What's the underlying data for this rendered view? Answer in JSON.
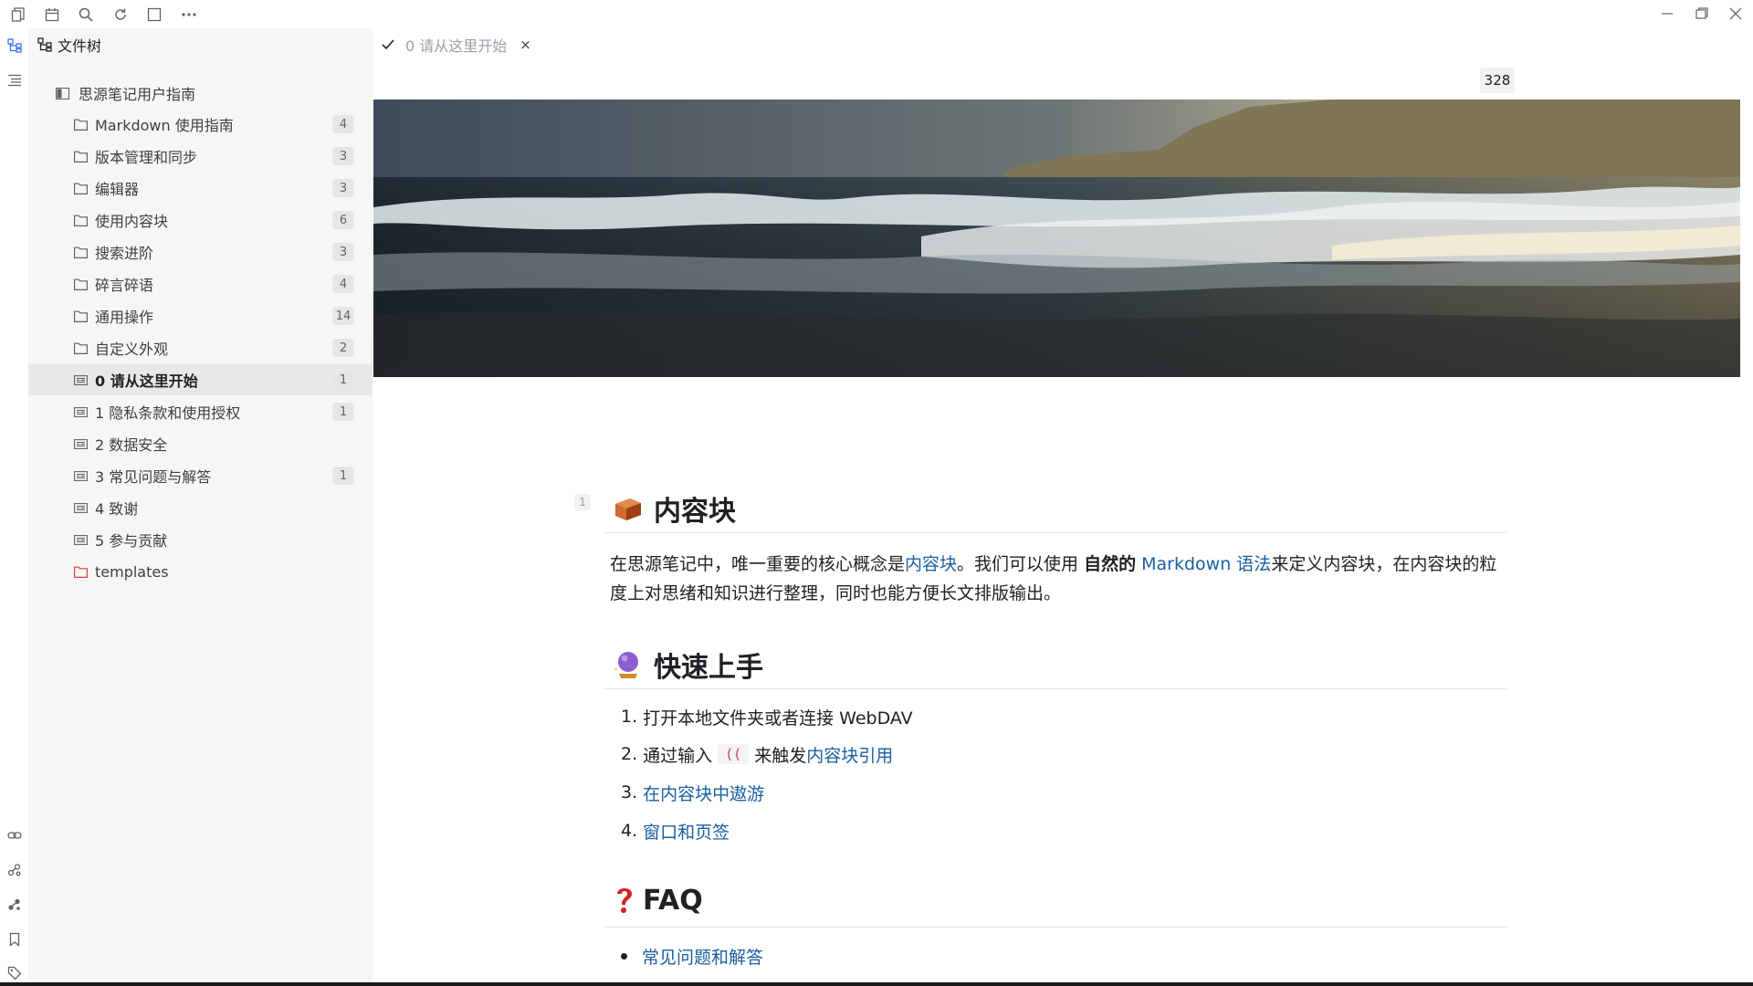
{
  "tree": {
    "title": "文件树",
    "notebook": "思源笔记用户指南",
    "items": [
      {
        "label": "Markdown 使用指南",
        "count": "4",
        "type": "folder"
      },
      {
        "label": "版本管理和同步",
        "count": "3",
        "type": "folder"
      },
      {
        "label": "编辑器",
        "count": "3",
        "type": "folder"
      },
      {
        "label": "使用内容块",
        "count": "6",
        "type": "folder"
      },
      {
        "label": "搜索进阶",
        "count": "3",
        "type": "folder"
      },
      {
        "label": "碎言碎语",
        "count": "4",
        "type": "folder"
      },
      {
        "label": "通用操作",
        "count": "14",
        "type": "folder"
      },
      {
        "label": "自定义外观",
        "count": "2",
        "type": "folder"
      },
      {
        "label": "0 请从这里开始",
        "count": "1",
        "type": "doc",
        "active": true
      },
      {
        "label": "1 隐私条款和使用授权",
        "count": "1",
        "type": "doc"
      },
      {
        "label": "2 数据安全",
        "count": "",
        "type": "doc"
      },
      {
        "label": "3 常见问题与解答",
        "count": "1",
        "type": "doc"
      },
      {
        "label": "4 致谢",
        "count": "",
        "type": "doc"
      },
      {
        "label": "5 参与贡献",
        "count": "",
        "type": "doc"
      },
      {
        "label": "templates",
        "count": "",
        "type": "folder-red"
      }
    ]
  },
  "tab": {
    "label": "0 请从这里开始",
    "close": "×"
  },
  "wordcount": "328",
  "doc": {
    "gutter": "1",
    "h1": "内容块",
    "p1_a": "在思源笔记中，唯一重要的核心概念是",
    "p1_link1": "内容块",
    "p1_b": "。我们可以使用 ",
    "p1_bold": "自然的",
    "p1_c": " ",
    "p1_link2": "Markdown 语法",
    "p1_d": "来定义内容块，在内容块的粒度上对思绪和知识进行整理，同时也能方便长文排版输出。",
    "h2": "快速上手",
    "steps": [
      {
        "num": "1.",
        "text": "打开本地文件夹或者连接 WebDAV"
      },
      {
        "num": "2.",
        "pre": "通过输入",
        "code": "((",
        "mid": "来触发",
        "link": "内容块引用"
      },
      {
        "num": "3.",
        "link": "在内容块中遨游"
      },
      {
        "num": "4.",
        "link": "窗口和页签"
      }
    ],
    "h3": "FAQ",
    "faq_link": "常见问题和解答"
  },
  "colors": {
    "link": "#1a5fa0",
    "code": "#d73a49",
    "panel": "#f6f6f4",
    "active": "#e8e8e6"
  }
}
